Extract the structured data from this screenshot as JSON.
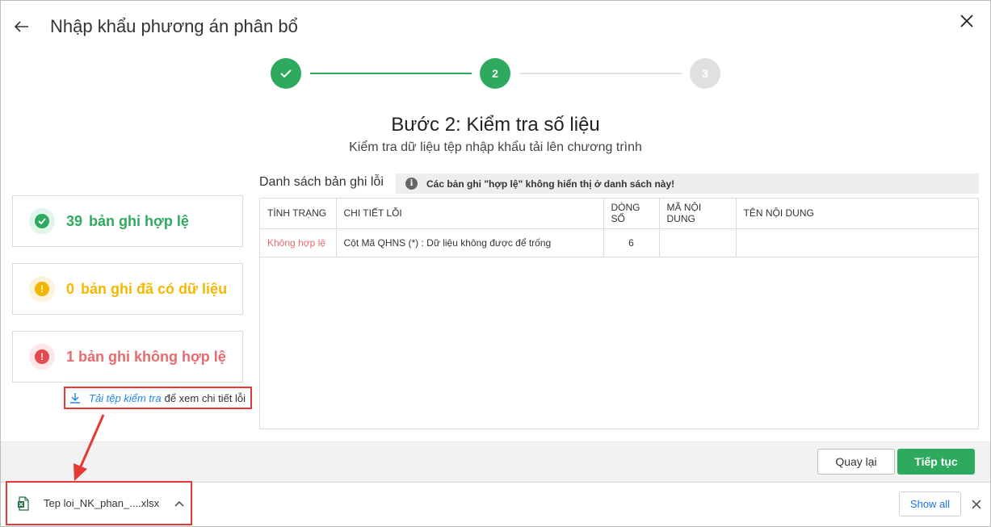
{
  "dialog": {
    "title": "Nhập khẩu phương án phân bổ"
  },
  "stepper": {
    "steps": [
      {
        "label": "",
        "state": "done"
      },
      {
        "label": "2",
        "state": "active"
      },
      {
        "label": "3",
        "state": "pending"
      }
    ],
    "heading": "Bước 2: Kiểm tra số liệu",
    "subheading": "Kiểm tra dữ liệu tệp nhập khẩu tải lên chương trình"
  },
  "summary": {
    "valid": {
      "count": "39",
      "label": "bản ghi hợp lệ",
      "color": "#2eaa5e"
    },
    "existing": {
      "count": "0",
      "label": "bản ghi đã có dữ liệu",
      "color": "#f5b800"
    },
    "invalid": {
      "count": "1",
      "label": "bản ghi không hợp lệ",
      "color": "#e86a6f"
    }
  },
  "download_check": {
    "link": "Tải tệp kiểm tra",
    "rest": "để xem chi tiết lỗi"
  },
  "error_list": {
    "title": "Danh sách bản ghi lỗi",
    "notice": "Các bản ghi \"hợp lệ\" không hiển thị ở danh sách này!",
    "columns": [
      "TÌNH TRẠNG",
      "CHI TIẾT LỖI",
      "DÒNG SỐ",
      "MÃ NỘI DUNG",
      "TÊN NỘI DUNG"
    ],
    "rows": [
      {
        "status": "Không hợp lệ",
        "detail": "Cột Mã QHNS (*) : Dữ liệu không được để trống",
        "line": "6",
        "code": "",
        "name": ""
      }
    ]
  },
  "footer": {
    "back_label": "Quay lại",
    "next_label": "Tiếp tục"
  },
  "download_bar": {
    "file_name": "Tep loi_NK_phan_....xlsx",
    "file_icon": "excel-file-icon",
    "show_all_label": "Show all"
  },
  "colors": {
    "accent": "#2eaa5e",
    "highlight_border": "#e53935",
    "link": "#1e88e5"
  }
}
